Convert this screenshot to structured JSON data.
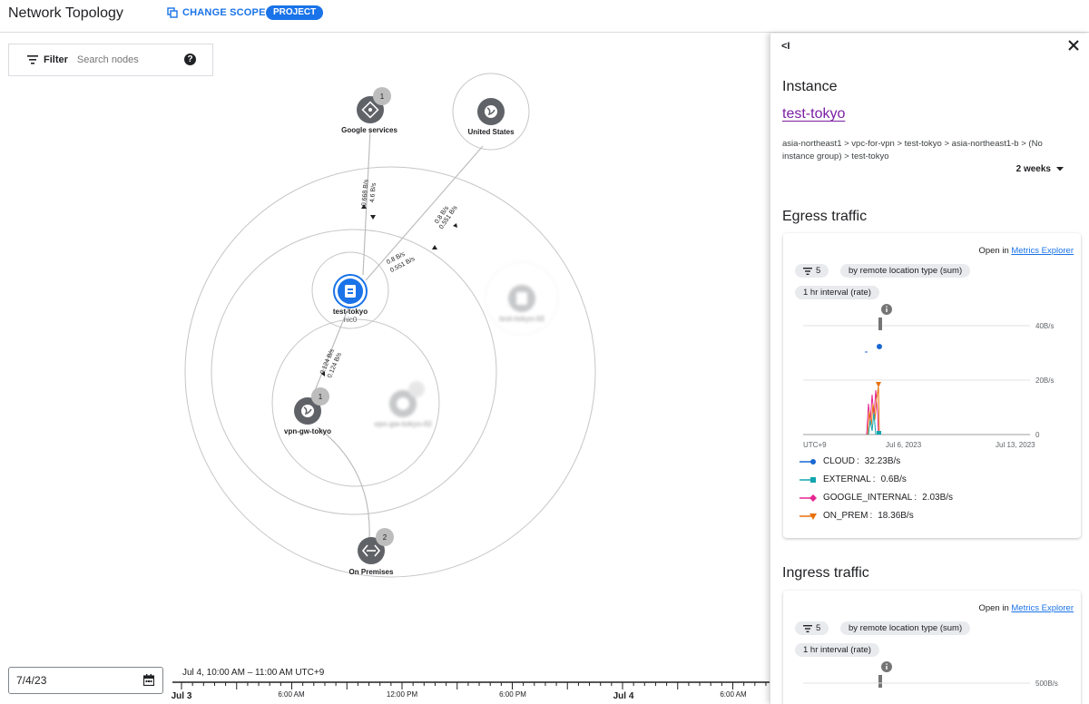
{
  "header": {
    "title": "Network Topology",
    "change_scope_label": "CHANGE SCOPE",
    "project_chip": "PROJECT"
  },
  "filter": {
    "label": "Filter",
    "search_placeholder": "Search nodes"
  },
  "topology": {
    "nodes": {
      "google_services": {
        "label": "Google services",
        "badge": "1"
      },
      "united_states": {
        "label": "United States"
      },
      "test_tokyo": {
        "label": "test-tokyo",
        "sub": "nic0"
      },
      "vpn_gw_tokyo": {
        "label": "vpn-gw-tokyo",
        "badge": "1"
      },
      "on_premises": {
        "label": "On Premises",
        "badge": "2"
      },
      "test_tokyo_02": {
        "label": "test-tokyo-02"
      },
      "vpn_gw_tokyo_02": {
        "label": "vpn-gw-tokyo-02"
      }
    },
    "edges": {
      "google_a": "0.668 B/s",
      "google_b": "4.6 B/s",
      "us_a": "0.8 B/s",
      "us_b": "0.551 B/s",
      "mid_a": "0.8 B/s",
      "mid_b": "0.551 B/s",
      "vpn_a": "0.124 B/s",
      "vpn_b": "0.124 B/s"
    }
  },
  "timeline": {
    "date_value": "7/4/23",
    "range": "Jul 4, 10:00 AM – 11:00 AM UTC+9",
    "ticks": [
      "Jul 3",
      "6:00 AM",
      "12:00 PM",
      "6:00 PM",
      "Jul 4",
      "6:00 AM"
    ]
  },
  "panel": {
    "instance_heading": "Instance",
    "instance_name": "test-tokyo",
    "breadcrumb": "asia-northeast1 > vpc-for-vpn > test-tokyo > asia-northeast1-b > (No instance group) > test-tokyo",
    "duration": "2 weeks",
    "egress": {
      "heading": "Egress traffic",
      "open_in": "Open in",
      "metrics_link": "Metrics Explorer",
      "filter_count": "5",
      "aggregation": "by remote location type (sum)",
      "interval": "1 hr interval (rate)",
      "y_ticks": [
        "40B/s",
        "20B/s",
        "0"
      ],
      "x_ticks": [
        "UTC+9",
        "Jul 6, 2023",
        "Jul 13, 2023"
      ],
      "legend": [
        {
          "name": "CLOUD",
          "value": "32.23B/s",
          "color": "#1967d2"
        },
        {
          "name": "EXTERNAL",
          "value": "0.6B/s",
          "color": "#12a4af"
        },
        {
          "name": "GOOGLE_INTERNAL",
          "value": "2.03B/s",
          "color": "#e52592"
        },
        {
          "name": "ON_PREM",
          "value": "18.36B/s",
          "color": "#e8710a"
        }
      ]
    },
    "ingress": {
      "heading": "Ingress traffic",
      "open_in": "Open in",
      "metrics_link": "Metrics Explorer",
      "filter_count": "5",
      "aggregation": "by remote location type (sum)",
      "interval": "1 hr interval (rate)",
      "y_ticks": [
        "500B/s"
      ]
    }
  }
}
